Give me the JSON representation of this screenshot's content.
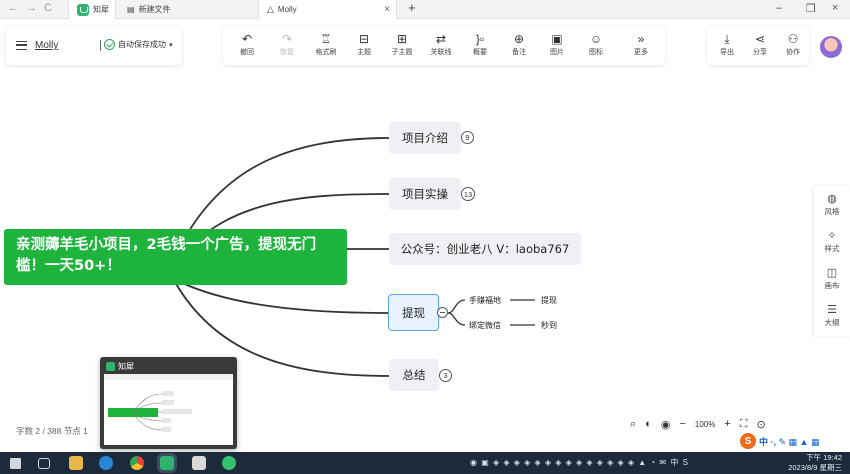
{
  "browser": {
    "nav": {
      "back": "←",
      "forward": "→",
      "reload": "C"
    },
    "tabs": [
      {
        "label": "知犀"
      },
      {
        "label": "新建文件"
      },
      {
        "label": "Molly",
        "close": "×"
      }
    ],
    "new_tab": "+",
    "window": {
      "minimize": "–",
      "restore": "❐",
      "close": "×"
    }
  },
  "file": {
    "name": "Molly",
    "save_status": "自动保存成功",
    "caret": "▾"
  },
  "toolbar": {
    "items": [
      {
        "icon": "undo-icon",
        "glyph": "↶",
        "label": "撤回"
      },
      {
        "icon": "redo-icon",
        "glyph": "↷",
        "label": "恢复"
      },
      {
        "icon": "format-painter-icon",
        "glyph": "♖",
        "label": "格式刷"
      },
      {
        "icon": "topic-icon",
        "glyph": "⊟",
        "label": "主题"
      },
      {
        "icon": "subtopic-icon",
        "glyph": "⊞",
        "label": "子主题"
      },
      {
        "icon": "relation-icon",
        "glyph": "⇄",
        "label": "关联线"
      },
      {
        "icon": "summary-icon",
        "glyph": "}▫",
        "label": "概要"
      },
      {
        "icon": "note-icon",
        "glyph": "⊕",
        "label": "备注"
      },
      {
        "icon": "image-icon",
        "glyph": "▣",
        "label": "图片"
      },
      {
        "icon": "emoji-icon",
        "glyph": "☺",
        "label": "图标"
      },
      {
        "icon": "more-icon",
        "glyph": "»",
        "label": "更多"
      }
    ],
    "right": [
      {
        "icon": "export-icon",
        "glyph": "⤓",
        "label": "导出"
      },
      {
        "icon": "share-icon",
        "glyph": "⋖",
        "label": "分享"
      },
      {
        "icon": "collaborate-icon",
        "glyph": "⚇",
        "label": "协作"
      }
    ]
  },
  "mindmap": {
    "root": "亲测薅羊毛小项目，2毛钱一个广告，提现无门槛！一天50+！",
    "branches": [
      {
        "label": "项目介绍",
        "badge": "9"
      },
      {
        "label": "项目实操",
        "badge": "13"
      },
      {
        "label": "公众号：创业老八  V：laoba767",
        "badge": ""
      },
      {
        "label": "提现",
        "badge": ""
      },
      {
        "label": "总结",
        "badge": "3"
      }
    ],
    "leaves": [
      {
        "parent": "手赚福地",
        "child": "提现"
      },
      {
        "parent": "绑定微信",
        "child": "秒到"
      }
    ]
  },
  "side_panel": [
    {
      "icon": "style-palette-icon",
      "glyph": "◍",
      "label": "风格"
    },
    {
      "icon": "format-icon",
      "glyph": "✧",
      "label": "样式"
    },
    {
      "icon": "layout-icon",
      "glyph": "◫",
      "label": "画布"
    },
    {
      "icon": "outline-icon",
      "glyph": "☰",
      "label": "大纲"
    }
  ],
  "minimap": {
    "title": "知犀"
  },
  "status": {
    "wordcount": "字数 2 / 388   节点 1"
  },
  "zoom": {
    "search": "⌕",
    "theme": "◐",
    "locate": "◉",
    "minus": "−",
    "value": "100%",
    "plus": "+",
    "fit": "⛶",
    "more": "⊙"
  },
  "ime": {
    "logo": "S",
    "text": "中 ·, ✎ ▦ ▲ ▦"
  },
  "taskbar": {
    "tray": "◉ ▣ ◈ ◈ ◈ ◈ ◈ ◈ ◈ ◈ ◈ ◈ ◈ ◈ ◈ ◈ ▲ ◔ ✉ 中 S",
    "time": "下午 19:42",
    "date": "2023/8/9 星期三"
  },
  "colors": {
    "accent": "#1eb33d",
    "selected_border": "#5aa4e8",
    "node_bg": "#eef0f3"
  }
}
